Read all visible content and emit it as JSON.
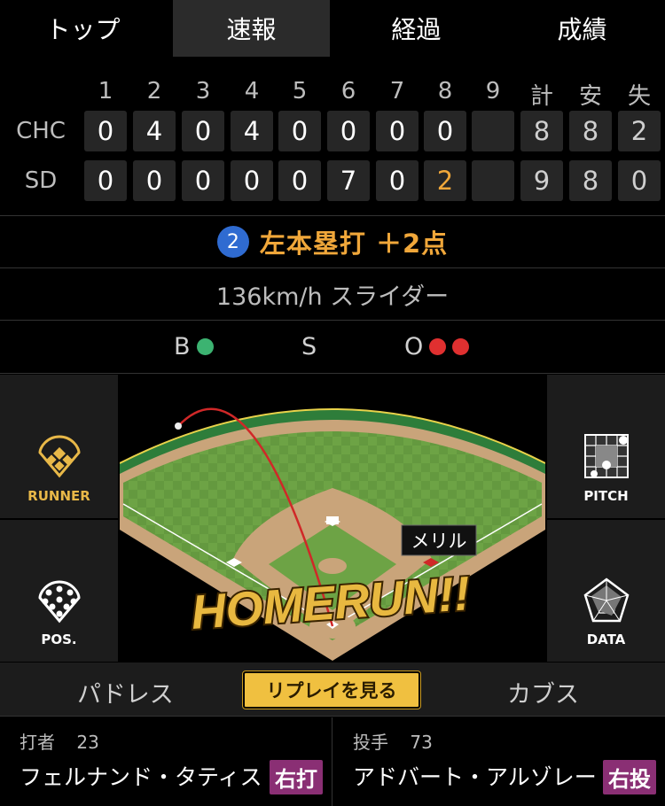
{
  "tabs": [
    "トップ",
    "速報",
    "経過",
    "成績"
  ],
  "active_tab": "速報",
  "scoreboard": {
    "headers": [
      "1",
      "2",
      "3",
      "4",
      "5",
      "6",
      "7",
      "8",
      "9",
      "計",
      "安",
      "失"
    ],
    "teams": [
      {
        "name": "CHC",
        "innings": [
          "0",
          "4",
          "0",
          "4",
          "0",
          "0",
          "0",
          "0",
          ""
        ],
        "totals": [
          "8",
          "8",
          "2"
        ]
      },
      {
        "name": "SD",
        "innings": [
          "0",
          "0",
          "0",
          "0",
          "0",
          "7",
          "0",
          "2",
          ""
        ],
        "totals": [
          "9",
          "8",
          "0"
        ]
      }
    ],
    "highlight_color": "#f0a73a"
  },
  "play": {
    "outs_badge": "2",
    "text": "左本塁打 ＋2点"
  },
  "pitch": {
    "text": "136km/h スライダー"
  },
  "count": {
    "b_label": "B",
    "s_label": "S",
    "o_label": "O",
    "balls": 1,
    "strikes": 0,
    "outs": 2,
    "ball_color": "#3cb371",
    "out_color": "#e03030"
  },
  "side_buttons": {
    "runner": "RUNNER",
    "pitch": "PITCH",
    "pos": "POS.",
    "data": "DATA"
  },
  "field": {
    "fielder_label": "メリル",
    "banner": "HOMERUN!!"
  },
  "team_tabs": {
    "home": "パドレス",
    "replay": "リプレイを見る",
    "away": "カブス"
  },
  "batter": {
    "role": "打者",
    "number": "23",
    "name": "フェルナンド・タティス",
    "hand": "右打"
  },
  "pitcher": {
    "role": "投手",
    "number": "73",
    "name": "アドバート・アルゾレー",
    "hand": "右投"
  }
}
